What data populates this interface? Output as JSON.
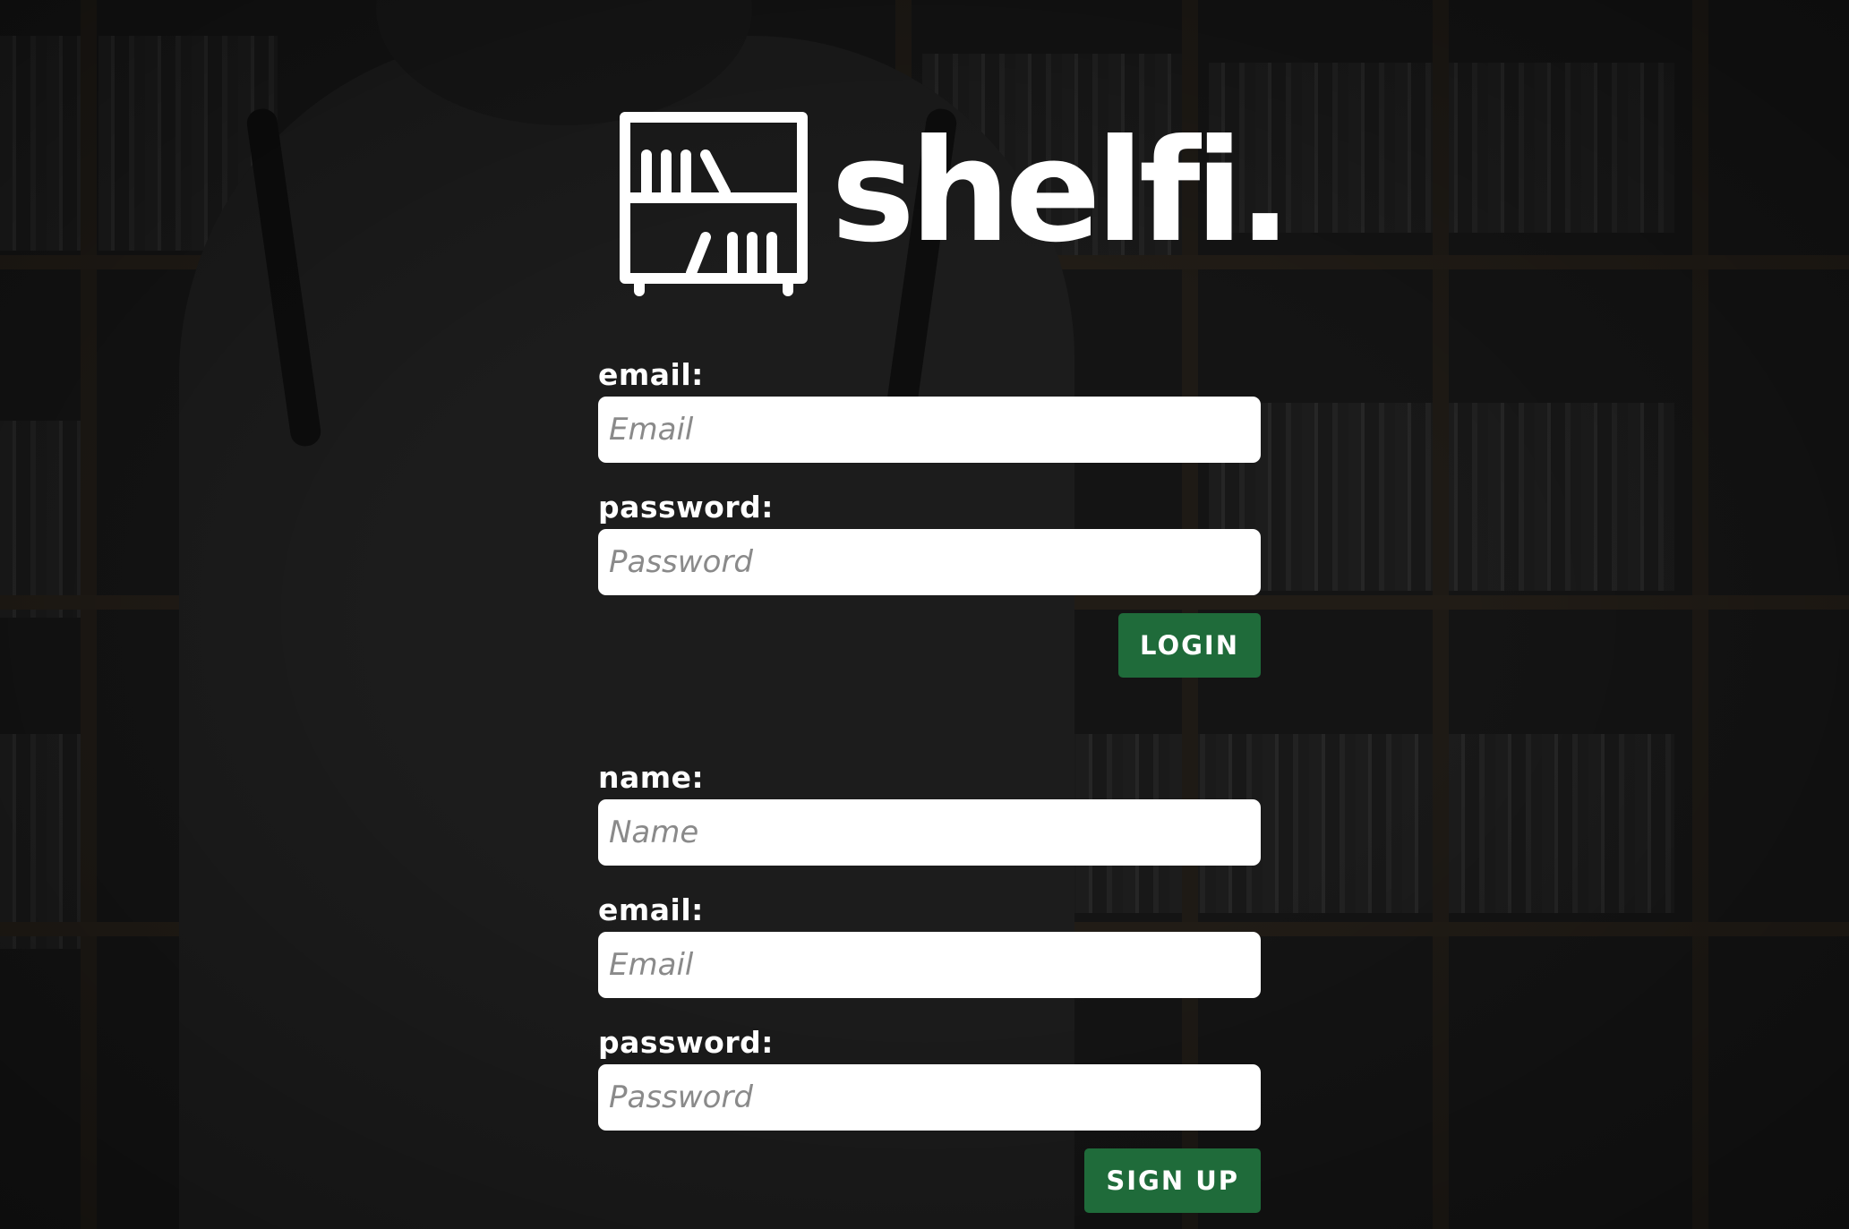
{
  "brand": {
    "name": "shelfi.",
    "logo_icon": "bookshelf-icon"
  },
  "login": {
    "email_label": "email:",
    "email_placeholder": "Email",
    "password_label": "password:",
    "password_placeholder": "Password",
    "submit_label": "LOGIN"
  },
  "signup": {
    "name_label": "name:",
    "name_placeholder": "Name",
    "email_label": "email:",
    "email_placeholder": "Email",
    "password_label": "password:",
    "password_placeholder": "Password",
    "submit_label": "SIGN UP"
  },
  "colors": {
    "button": "#1f6b3a",
    "text": "#ffffff",
    "input_bg": "#ffffff",
    "backdrop": "#141414"
  }
}
